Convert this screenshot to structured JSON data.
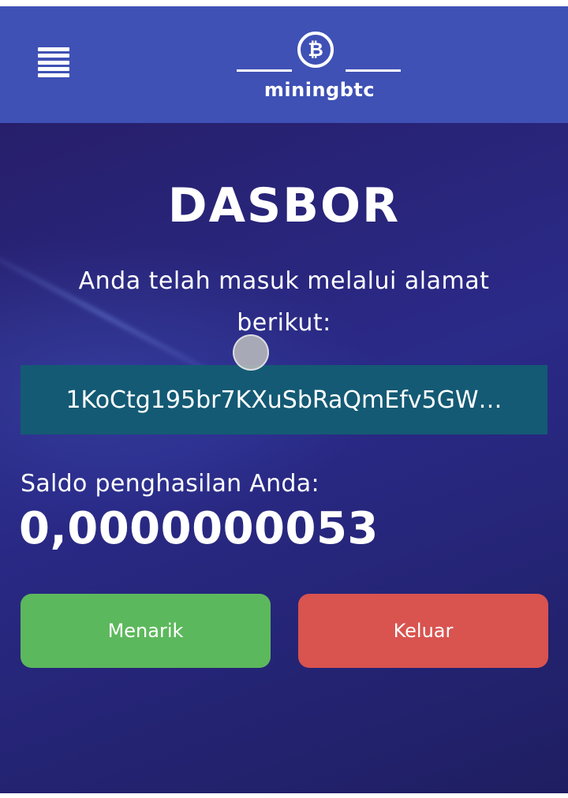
{
  "header": {
    "logo_text": "miningbtc",
    "logo_symbol": "₿",
    "icons": {
      "menu": "hamburger-menu-icon",
      "logo": "bitcoin-coin-icon"
    },
    "background_color": "#3f51b5"
  },
  "main": {
    "title": "DASBOR",
    "subtitle": "Anda telah masuk melalui alamat berikut:",
    "address": "1KoCtg195br7KXuSbRaQmEfv5GW…",
    "balance_label": "Saldo penghasilan Anda:",
    "balance_value": "0,0000000053"
  },
  "buttons": {
    "withdraw_label": "Menarik",
    "logout_label": "Keluar"
  },
  "colors": {
    "background": "#26206a",
    "address_box": "#145a74",
    "withdraw": "#5cb85c",
    "logout": "#d9534f"
  }
}
